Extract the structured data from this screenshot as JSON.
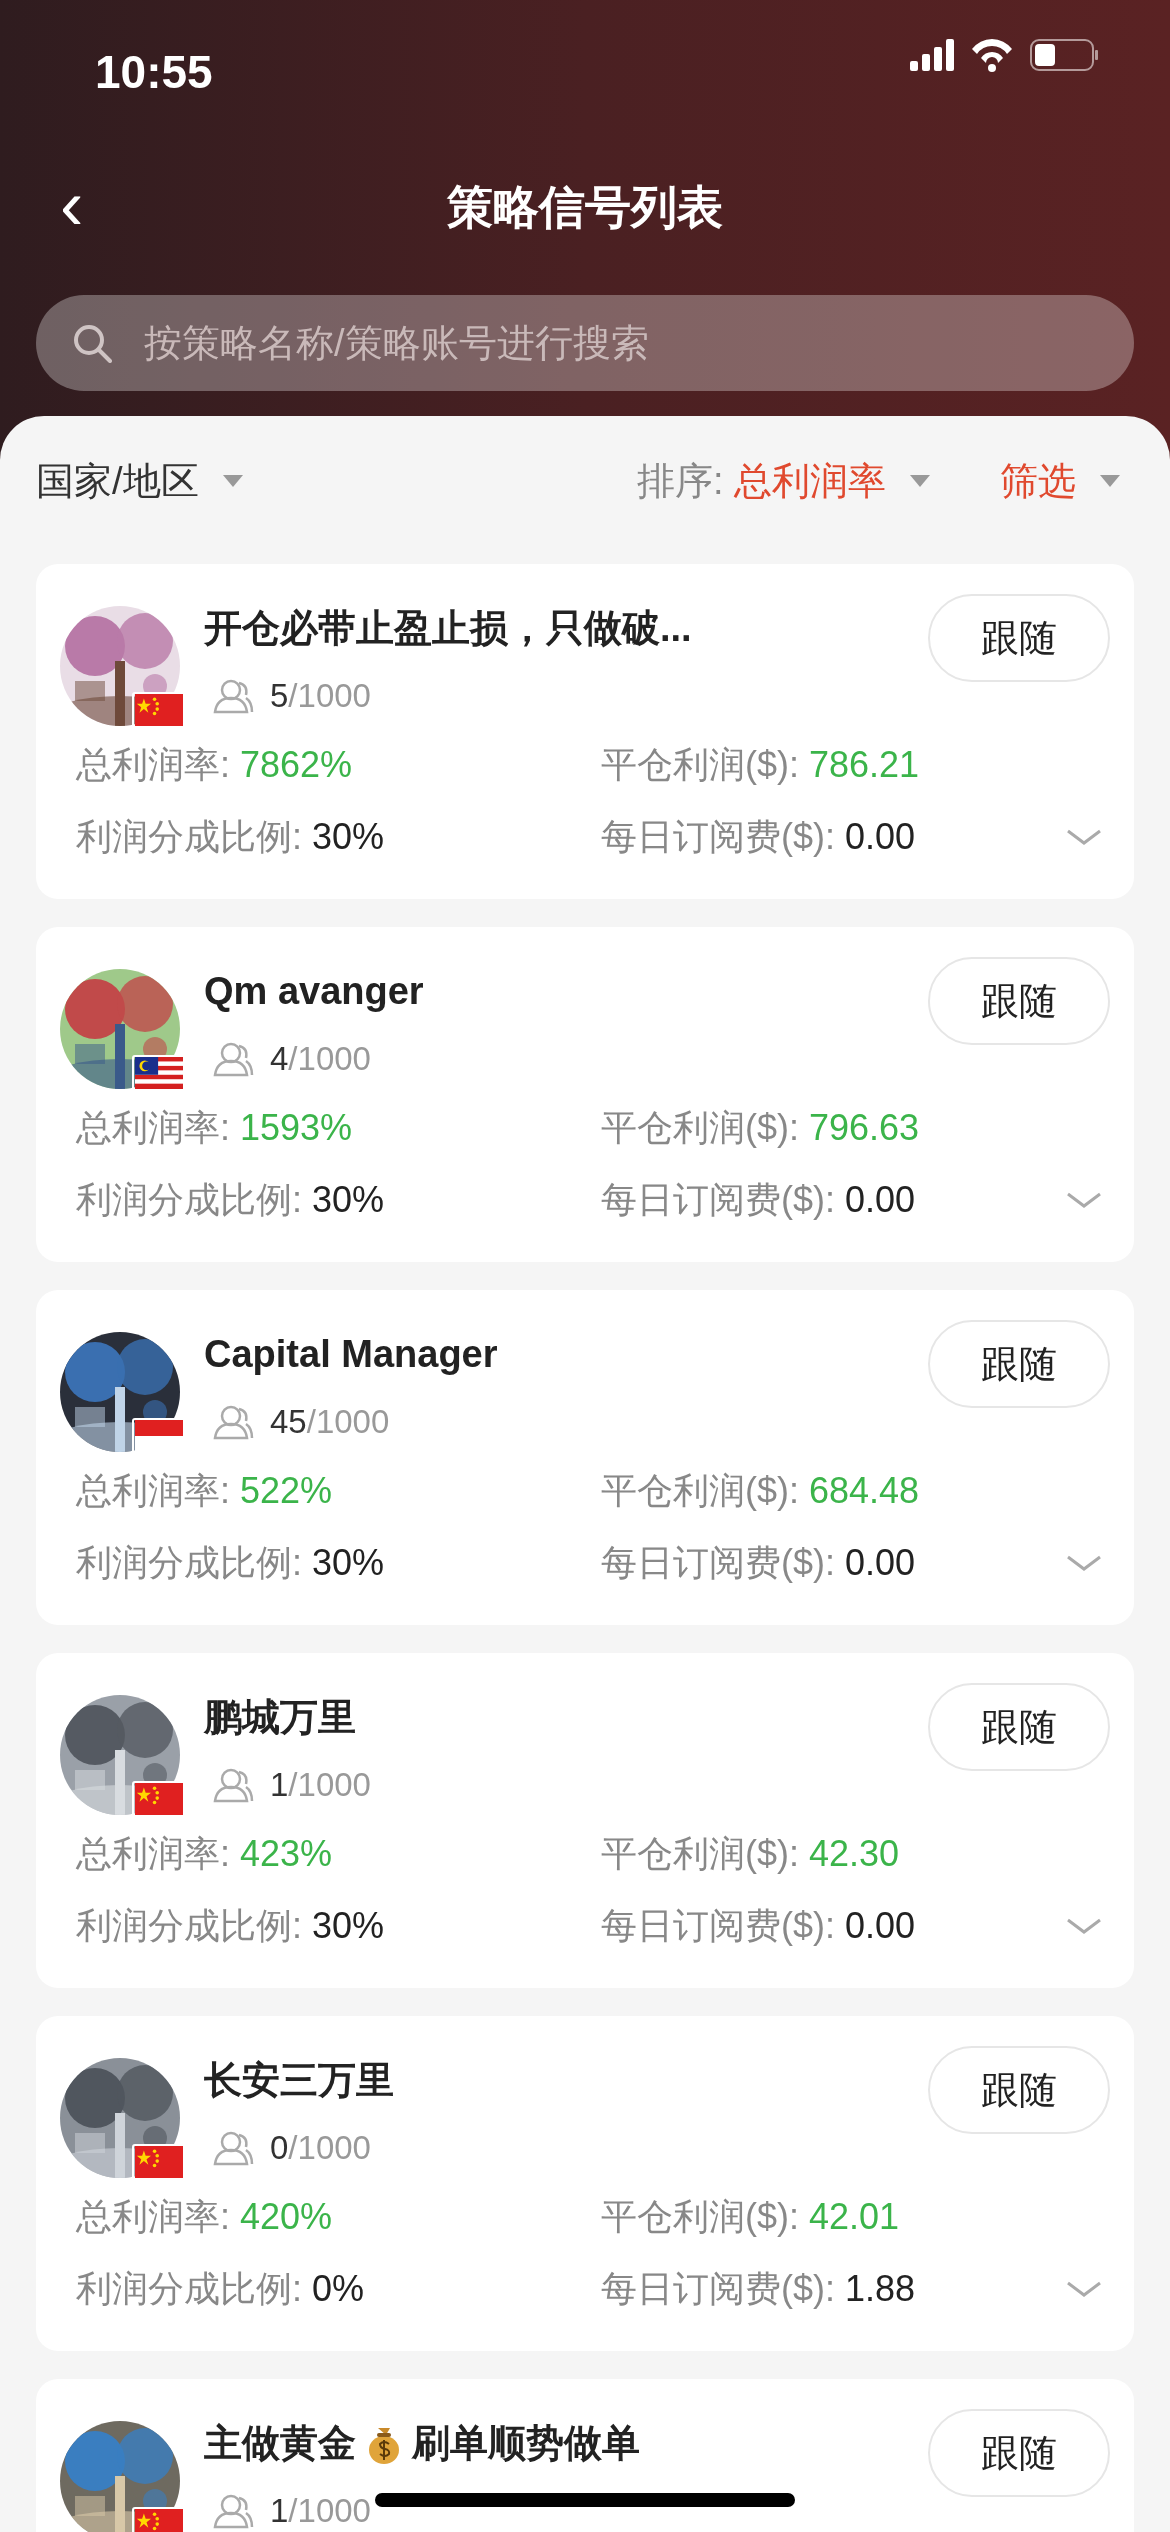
{
  "status_bar": {
    "time": "10:55"
  },
  "header": {
    "title": "策略信号列表",
    "back": "‹"
  },
  "search": {
    "placeholder": "按策略名称/策略账号进行搜索"
  },
  "filters": {
    "region": {
      "label": "国家/地区"
    },
    "sort": {
      "label": "排序:",
      "value": "总利润率"
    },
    "filter": {
      "label": "筛选"
    }
  },
  "strategies": [
    {
      "title": "开仓必带止盈止损，只做破...",
      "flag": {
        "kind": "china"
      },
      "followers": "5",
      "capacity": "/1000",
      "button": "跟随",
      "metrics": [
        {
          "label": "总利润率:",
          "value": "7862%",
          "kind": "profit"
        },
        {
          "label": "平仓利润($):",
          "value": "786.21",
          "kind": "profit"
        },
        {
          "label": "利润分成比例:",
          "value": "30%",
          "kind": "plain"
        },
        {
          "label": "每日订阅费($):",
          "value": "0.00",
          "kind": "plain"
        }
      ]
    },
    {
      "title": "Qm avanger",
      "flag": {
        "kind": "malaysia"
      },
      "followers": "4",
      "capacity": "/1000",
      "button": "跟随",
      "metrics": [
        {
          "label": "总利润率:",
          "value": "1593%",
          "kind": "profit"
        },
        {
          "label": "平仓利润($):",
          "value": "796.63",
          "kind": "profit"
        },
        {
          "label": "利润分成比例:",
          "value": "30%",
          "kind": "plain"
        },
        {
          "label": "每日订阅费($):",
          "value": "0.00",
          "kind": "plain"
        }
      ]
    },
    {
      "title": "Capital Manager",
      "flag": {
        "kind": "indonesia"
      },
      "followers": "45",
      "capacity": "/1000",
      "button": "跟随",
      "metrics": [
        {
          "label": "总利润率:",
          "value": "522%",
          "kind": "profit"
        },
        {
          "label": "平仓利润($):",
          "value": "684.48",
          "kind": "profit"
        },
        {
          "label": "利润分成比例:",
          "value": "30%",
          "kind": "plain"
        },
        {
          "label": "每日订阅费($):",
          "value": "0.00",
          "kind": "plain"
        }
      ]
    },
    {
      "title": "鹏城万里",
      "flag": {
        "kind": "china"
      },
      "followers": "1",
      "capacity": "/1000",
      "button": "跟随",
      "metrics": [
        {
          "label": "总利润率:",
          "value": "423%",
          "kind": "profit"
        },
        {
          "label": "平仓利润($):",
          "value": "42.30",
          "kind": "profit"
        },
        {
          "label": "利润分成比例:",
          "value": "30%",
          "kind": "plain"
        },
        {
          "label": "每日订阅费($):",
          "value": "0.00",
          "kind": "plain"
        }
      ]
    },
    {
      "title": "长安三万里",
      "flag": {
        "kind": "china"
      },
      "followers": "0",
      "capacity": "/1000",
      "button": "跟随",
      "metrics": [
        {
          "label": "总利润率:",
          "value": "420%",
          "kind": "profit"
        },
        {
          "label": "平仓利润($):",
          "value": "42.01",
          "kind": "profit"
        },
        {
          "label": "利润分成比例:",
          "value": "0%",
          "kind": "plain"
        },
        {
          "label": "每日订阅费($):",
          "value": "1.88",
          "kind": "plain"
        }
      ]
    },
    {
      "title": "主做黄金",
      "title_after": "刷单顺势做单",
      "flag": {
        "kind": "china"
      },
      "followers": "1",
      "capacity": "/1000",
      "button": "跟随"
    }
  ]
}
